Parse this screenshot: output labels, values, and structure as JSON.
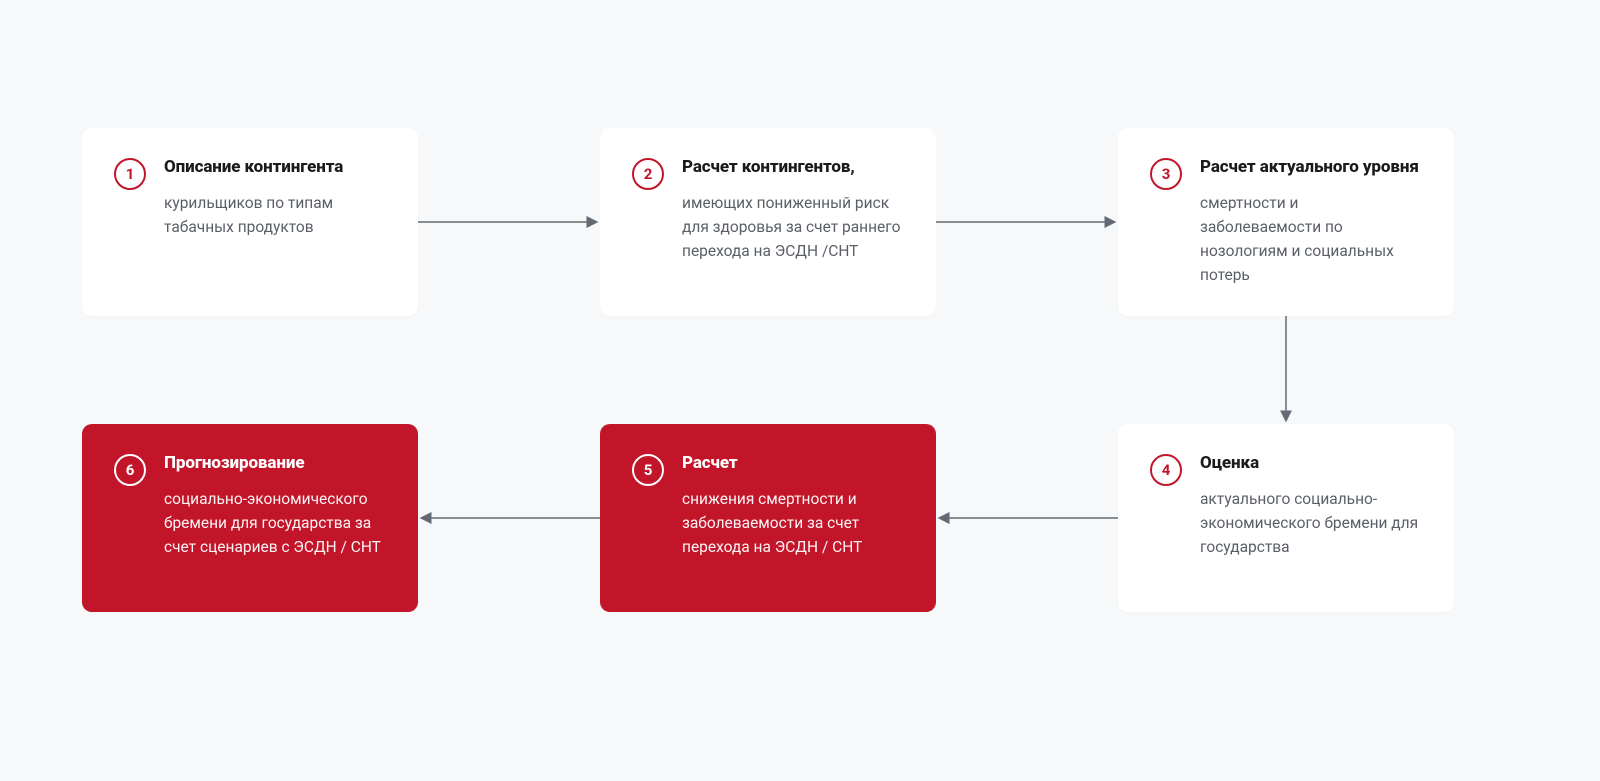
{
  "colors": {
    "accent": "#c2152a",
    "bg": "#f6f8f9",
    "card_bg": "#ffffff",
    "text": "#1b1b1d",
    "muted": "#5a5f66",
    "arrow": "#646a73"
  },
  "steps": [
    {
      "num": "1",
      "title": "Описание контингента",
      "desc": "курильщиков по типам табачных продуктов",
      "variant": "white"
    },
    {
      "num": "2",
      "title": "Расчет контингентов,",
      "desc": "имеющих пониженный риск для здоровья за счет раннего перехода на ЭСДН /СНТ",
      "variant": "white"
    },
    {
      "num": "3",
      "title": "Расчет актуального уровня",
      "desc": "смертности и заболеваемости по нозологиям и социальных потерь",
      "variant": "white"
    },
    {
      "num": "4",
      "title": "Оценка",
      "desc": "актуального социально-экономического бремени для государства",
      "variant": "white"
    },
    {
      "num": "5",
      "title": "Расчет",
      "desc": "снижения смертности и заболеваемости за счет перехода на ЭСДН / СНТ",
      "variant": "red"
    },
    {
      "num": "6",
      "title": "Прогнозирование",
      "desc": "социально-экономического бремени для государства за счет сценариев с ЭСДН / СНТ",
      "variant": "red"
    }
  ]
}
